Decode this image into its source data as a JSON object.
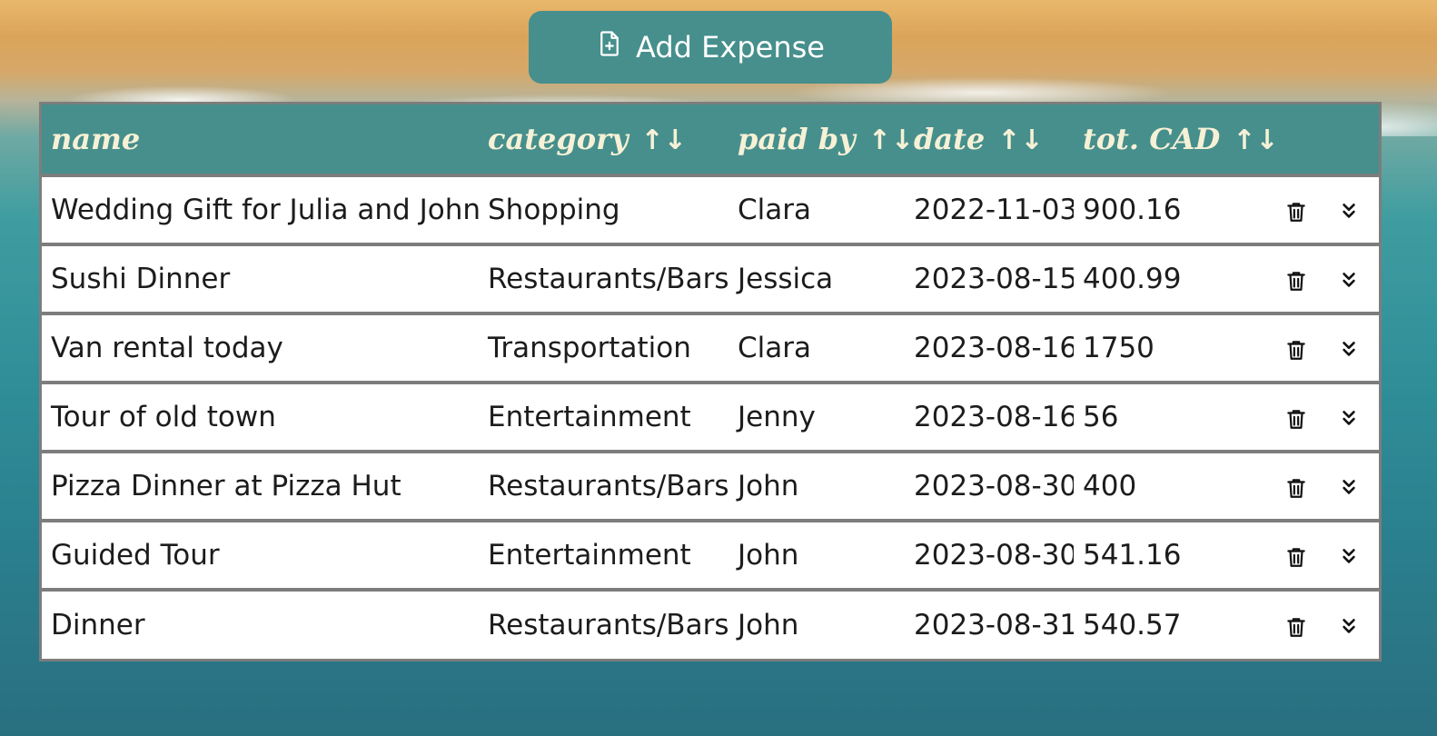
{
  "toolbar": {
    "add_label": "Add Expense"
  },
  "table": {
    "columns": [
      {
        "label": "name",
        "sortable": false
      },
      {
        "label": "category",
        "sortable": true
      },
      {
        "label": "paid by",
        "sortable": true
      },
      {
        "label": "date",
        "sortable": true
      },
      {
        "label": "tot. CAD",
        "sortable": true
      }
    ],
    "sort_icon": "↑↓",
    "rows": [
      {
        "name": "Wedding Gift for Julia and John",
        "category": "Shopping",
        "paid_by": "Clara",
        "date": "2022-11-03",
        "total": "900.16"
      },
      {
        "name": "Sushi Dinner",
        "category": "Restaurants/Bars",
        "paid_by": "Jessica",
        "date": "2023-08-15",
        "total": "400.99"
      },
      {
        "name": "Van rental today",
        "category": "Transportation",
        "paid_by": "Clara",
        "date": "2023-08-16",
        "total": "1750"
      },
      {
        "name": "Tour of old town",
        "category": "Entertainment",
        "paid_by": "Jenny",
        "date": "2023-08-16",
        "total": "56"
      },
      {
        "name": "Pizza Dinner at Pizza Hut",
        "category": "Restaurants/Bars",
        "paid_by": "John",
        "date": "2023-08-30",
        "total": "400"
      },
      {
        "name": "Guided Tour",
        "category": "Entertainment",
        "paid_by": "John",
        "date": "2023-08-30",
        "total": "541.16"
      },
      {
        "name": "Dinner",
        "category": "Restaurants/Bars",
        "paid_by": "John",
        "date": "2023-08-31",
        "total": "540.57"
      }
    ]
  },
  "colors": {
    "header_bg": "#468f8c",
    "header_text": "#f6f1d6",
    "row_bg": "#ffffff",
    "border": "#7d7d7d"
  },
  "icons": {
    "add": "file-plus-icon",
    "delete": "trash-icon",
    "expand": "chevron-double-down-icon"
  }
}
